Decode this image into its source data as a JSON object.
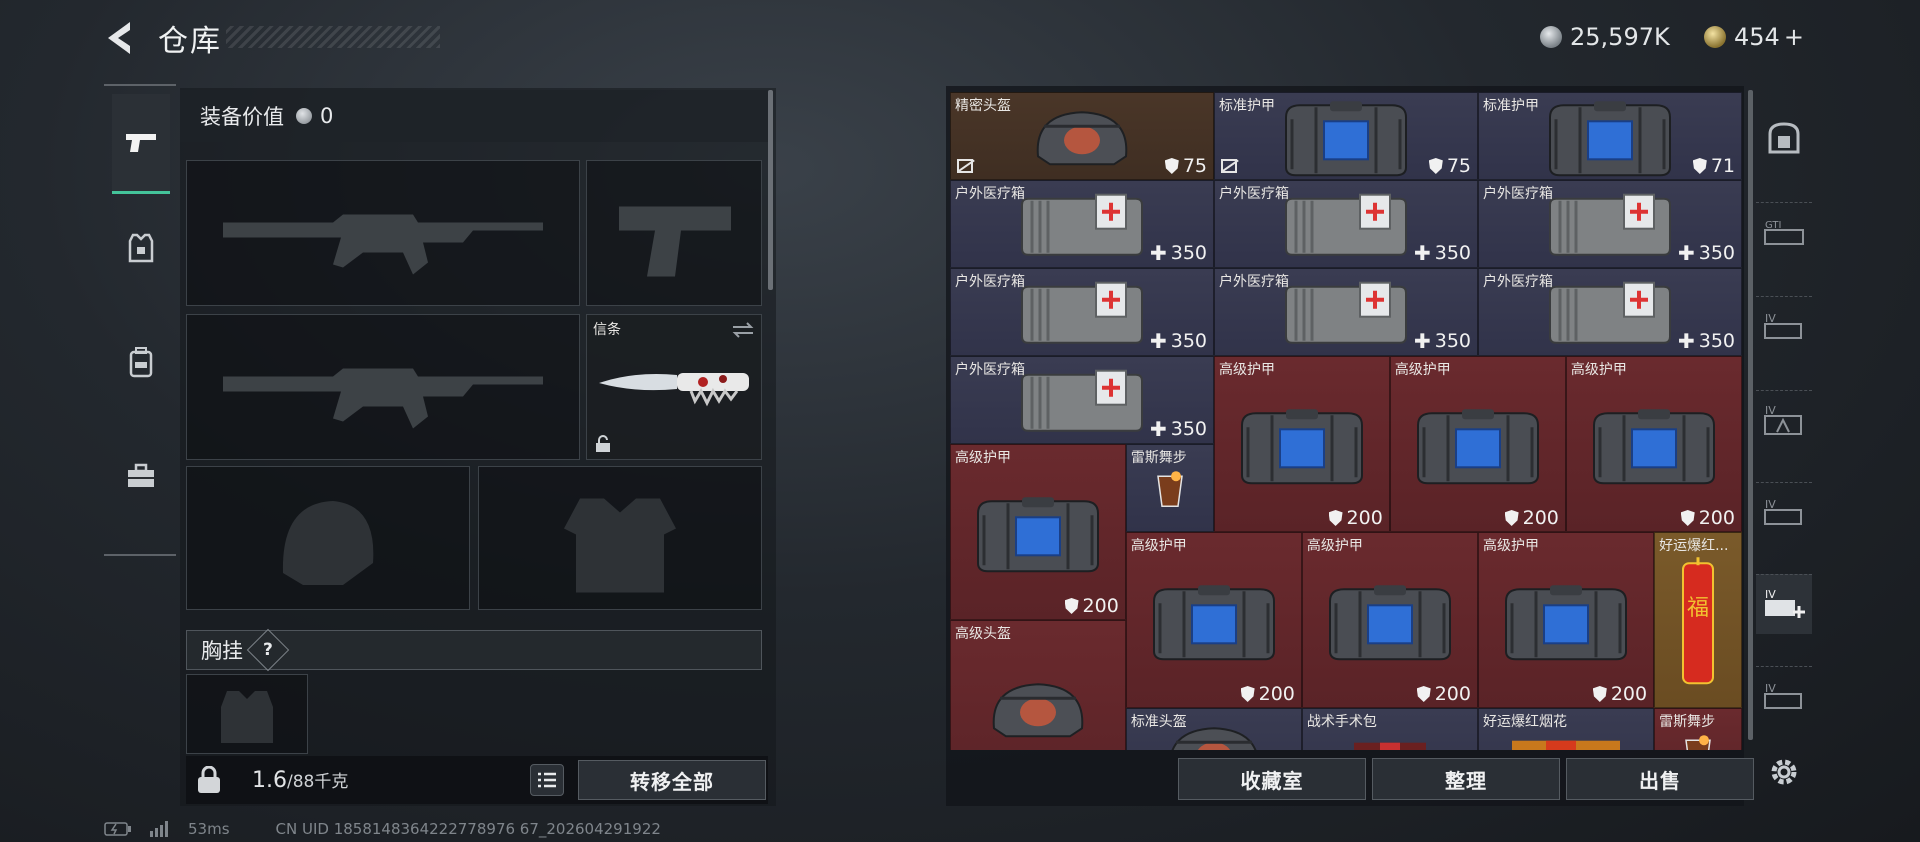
{
  "header": {
    "title": "仓库",
    "currency1": "25,597K",
    "currency2": "454",
    "currency2_plus": "+"
  },
  "loadout": {
    "equip_value_label": "装备价值",
    "equip_value": "0",
    "melee_label": "信条",
    "chest_label": "胸挂",
    "chest_help": "?",
    "weight_current": "1.6",
    "weight_max": "/88千克",
    "transfer_all": "转移全部"
  },
  "grid": {
    "items": [
      {
        "name": "精密头盔",
        "value": "75",
        "vtype": "shield",
        "bg": "brown",
        "art": "helmet",
        "locked": true
      },
      {
        "name": "标准护甲",
        "value": "75",
        "vtype": "shield",
        "bg": "gray",
        "art": "armor",
        "locked": true
      },
      {
        "name": "标准护甲",
        "value": "71",
        "vtype": "shield",
        "bg": "gray",
        "art": "armor",
        "locked": false
      },
      {
        "name": "户外医疗箱",
        "value": "350",
        "vtype": "plus",
        "bg": "gray",
        "art": "medkit"
      },
      {
        "name": "户外医疗箱",
        "value": "350",
        "vtype": "plus",
        "bg": "gray",
        "art": "medkit"
      },
      {
        "name": "户外医疗箱",
        "value": "350",
        "vtype": "plus",
        "bg": "gray",
        "art": "medkit"
      },
      {
        "name": "户外医疗箱",
        "value": "350",
        "vtype": "plus",
        "bg": "gray",
        "art": "medkit"
      },
      {
        "name": "户外医疗箱",
        "value": "350",
        "vtype": "plus",
        "bg": "gray",
        "art": "medkit"
      },
      {
        "name": "户外医疗箱",
        "value": "350",
        "vtype": "plus",
        "bg": "gray",
        "art": "medkit"
      },
      {
        "name": "户外医疗箱",
        "value": "350",
        "vtype": "plus",
        "bg": "gray",
        "art": "medkit"
      },
      {
        "name": "高级护甲",
        "value": "200",
        "vtype": "shield",
        "bg": "red",
        "art": "armor"
      },
      {
        "name": "高级护甲",
        "value": "200",
        "vtype": "shield",
        "bg": "red",
        "art": "armor"
      },
      {
        "name": "高级护甲",
        "value": "200",
        "vtype": "shield",
        "bg": "red",
        "art": "armor"
      },
      {
        "name": "高级护甲",
        "value": "200",
        "vtype": "shield",
        "bg": "red",
        "art": "armor"
      },
      {
        "name": "雷斯舞步",
        "value": "",
        "vtype": "none",
        "bg": "gray",
        "art": "drink"
      },
      {
        "name": "高级护甲",
        "value": "200",
        "vtype": "shield",
        "bg": "red",
        "art": "armor"
      },
      {
        "name": "高级护甲",
        "value": "200",
        "vtype": "shield",
        "bg": "red",
        "art": "armor"
      },
      {
        "name": "高级护甲",
        "value": "200",
        "vtype": "shield",
        "bg": "red",
        "art": "armor"
      },
      {
        "name": "好运爆红...",
        "value": "",
        "vtype": "none",
        "bg": "gold",
        "art": "firecracker"
      },
      {
        "name": "高级头盔",
        "value": "",
        "vtype": "none",
        "bg": "red",
        "art": "helmet"
      },
      {
        "name": "标准头盔",
        "value": "",
        "vtype": "none",
        "bg": "gray",
        "art": "helmet"
      },
      {
        "name": "战术手术包",
        "value": "",
        "vtype": "none",
        "bg": "gray",
        "art": "bag"
      },
      {
        "name": "好运爆红烟花",
        "value": "",
        "vtype": "none",
        "bg": "gray",
        "art": "fireworks"
      },
      {
        "name": "雷斯舞步",
        "value": "",
        "vtype": "none",
        "bg": "red",
        "art": "drink"
      }
    ],
    "buttons": {
      "collection": "收藏室",
      "organize": "整理",
      "sell": "出售"
    }
  },
  "right_nav": [
    "safe-icon",
    "gti-case-icon",
    "tier4-case-icon",
    "tier4-armor-case-icon",
    "tier4-ammo-case-icon",
    "tier4-medical-case-icon",
    "tier4-storage-icon",
    "settings-icon"
  ],
  "status": {
    "ping": "53ms",
    "uid": "CN UID 1858148364222778976 67_202604291922"
  },
  "colors": {
    "accent_green": "#44c49a",
    "cell_gray": "#383a50",
    "cell_red": "#642629",
    "cell_brown": "#47342a",
    "cell_gold": "#745626"
  }
}
